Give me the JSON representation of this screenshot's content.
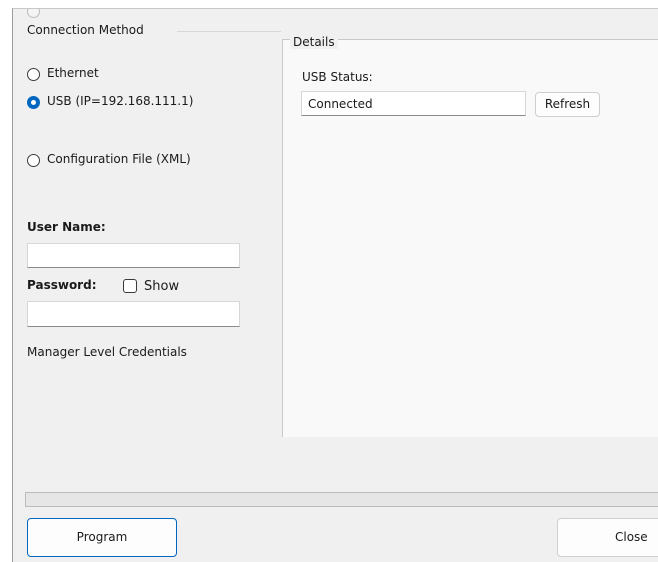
{
  "connection_method": {
    "legend": "Connection Method",
    "options": [
      {
        "label": "Ethernet",
        "checked": false
      },
      {
        "label": "USB (IP=192.168.111.1)",
        "checked": true
      },
      {
        "label": "Configuration File (XML)",
        "checked": false
      }
    ]
  },
  "credentials": {
    "user_name_label": "User Name:",
    "user_name_value": "",
    "password_label": "Password:",
    "password_value": "",
    "show_label": "Show",
    "show_checked": false,
    "note": "Manager Level Credentials"
  },
  "details": {
    "legend": "Details",
    "usb_status_label": "USB Status:",
    "usb_status_value": "Connected",
    "refresh_label": "Refresh"
  },
  "progress": {
    "value": 0
  },
  "footer": {
    "program_label": "Program",
    "close_label": "Close"
  },
  "colors": {
    "accent": "#0067c0",
    "window_bg": "#f0f0f0",
    "details_bg": "#f9f9f9"
  }
}
